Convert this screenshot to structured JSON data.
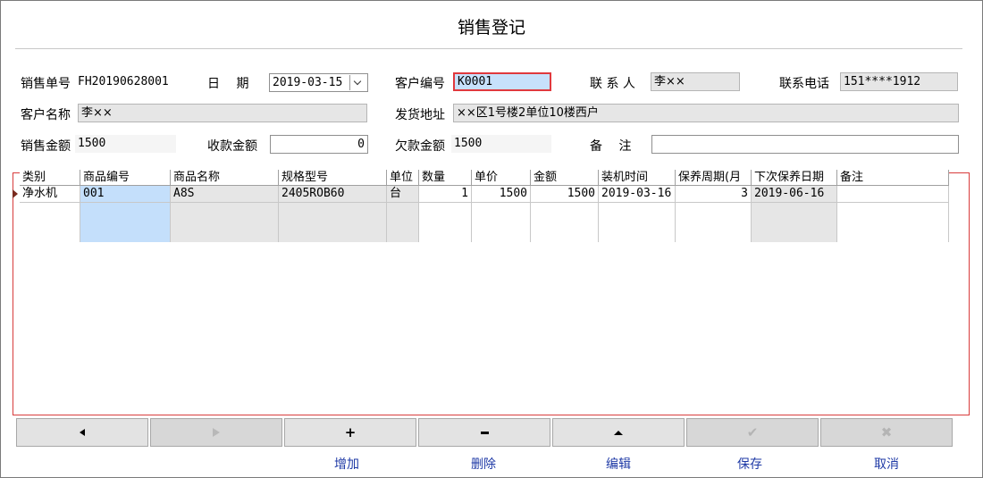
{
  "window": {
    "title": "销售登记"
  },
  "header": {
    "order_no_label": "销售单号",
    "order_no": "FH20190628001",
    "date_label": "日　 期",
    "date": "2019-03-15",
    "customer_code_label": "客户编号",
    "customer_code": "K0001",
    "contact_label": "联 系 人",
    "contact": "李××",
    "phone_label": "联系电话",
    "phone": "151****1912",
    "customer_name_label": "客户名称",
    "customer_name": "李××",
    "address_label": "发货地址",
    "address": "××区1号楼2单位10楼西户",
    "sales_amount_label": "销售金额",
    "sales_amount": "1500",
    "received_label": "收款金额",
    "received": "0",
    "owed_label": "欠款金额",
    "owed": "1500",
    "remark_label": "备　 注",
    "remark": ""
  },
  "grid": {
    "columns": [
      "类别",
      "商品编号",
      "商品名称",
      "规格型号",
      "单位",
      "数量",
      "单价",
      "金额",
      "装机时间",
      "保养周期(月",
      "下次保养日期",
      "备注"
    ],
    "rows": [
      [
        "净水机",
        "001",
        "A8S",
        "2405ROB60",
        "台",
        "1",
        "1500",
        "1500",
        "2019-03-16",
        "3",
        "2019-06-16",
        ""
      ]
    ]
  },
  "toolbar": {
    "add": "增加",
    "delete": "删除",
    "edit": "编辑",
    "save": "保存",
    "cancel": "取消"
  },
  "colors": {
    "accent_red": "#e0393e",
    "link_blue": "#1f3aa6",
    "selected_blue": "#c4dffb"
  }
}
